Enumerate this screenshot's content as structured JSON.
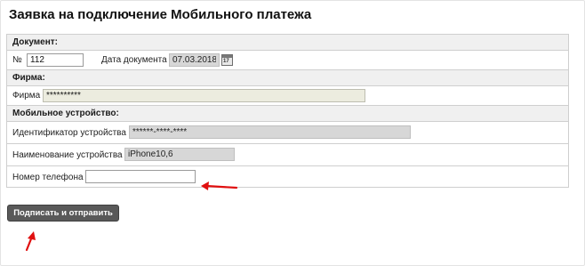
{
  "title": "Заявка на подключение Мобильного платежа",
  "document": {
    "section_label": "Документ:",
    "number_label": "№",
    "number_value": "112",
    "date_label": "Дата документа",
    "date_value": "07.03.2018",
    "calendar_icon": "calendar-icon",
    "calendar_day": "17"
  },
  "firm": {
    "section_label": "Фирма:",
    "field_label": "Фирма",
    "field_value": "**********"
  },
  "mobile": {
    "section_label": "Мобильное устройство:",
    "device_id_label": "Идентификатор устройства",
    "device_id_value": "******-****-****",
    "device_name_label": "Наименование устройства",
    "device_name_value": "iPhone10,6",
    "phone_label": "Номер телефона",
    "phone_value": ""
  },
  "submit_label": "Подписать и отправить",
  "annotation_color": "#e01010"
}
